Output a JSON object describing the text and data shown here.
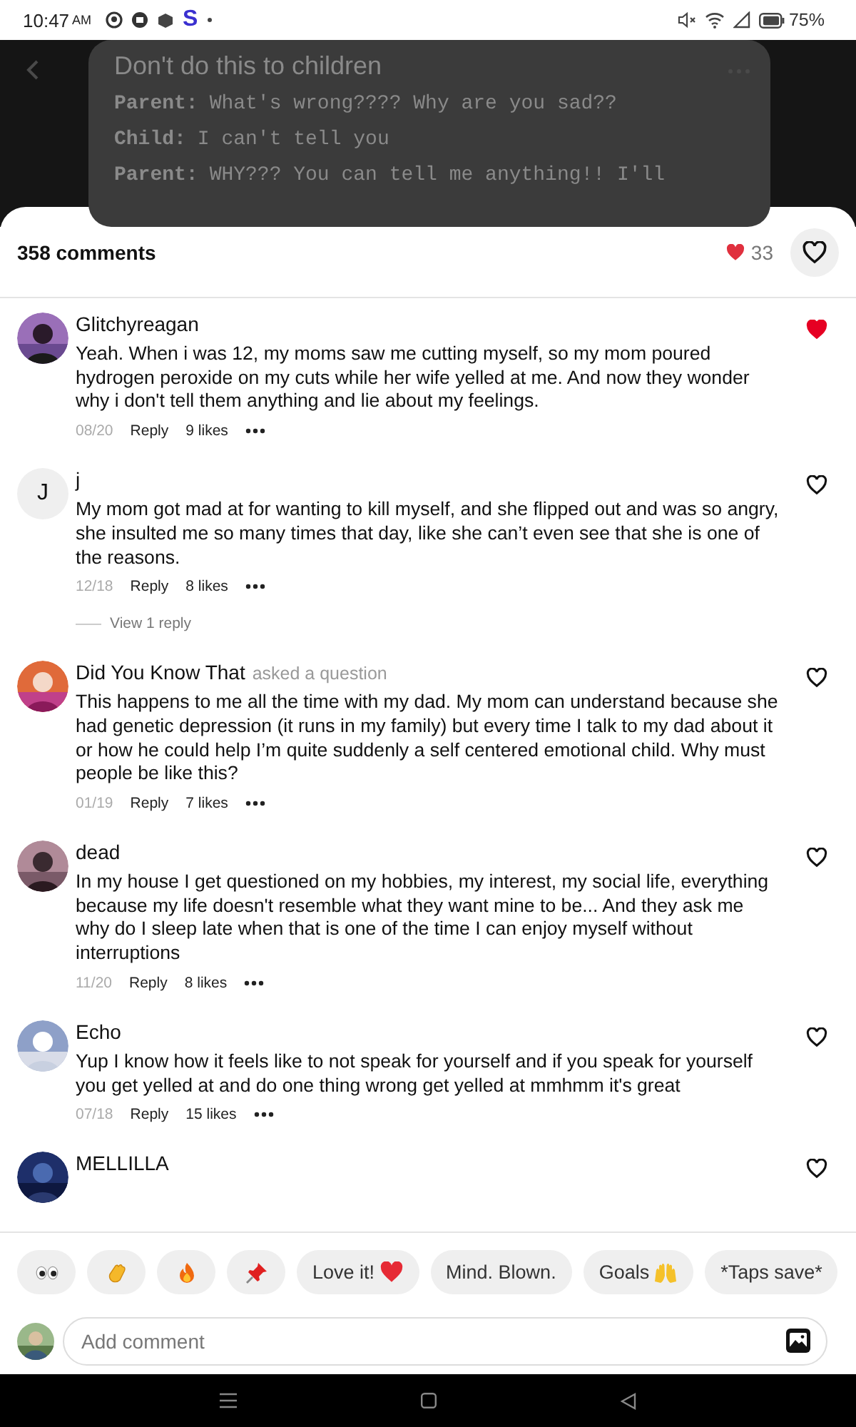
{
  "status_bar": {
    "time": "10:47",
    "ampm": "AM",
    "app_letter": "S",
    "battery": "75%"
  },
  "post": {
    "title": "Don't do this to children",
    "lines": [
      {
        "speaker": "Parent:",
        "text": "What's wrong???? Why are you sad??"
      },
      {
        "speaker": "Child:",
        "text": "I can't tell you"
      },
      {
        "speaker": "Parent:",
        "text": "WHY??? You can tell me anything!! I'll"
      }
    ]
  },
  "sheet": {
    "count": "358 comments",
    "likes": "33",
    "liked": false
  },
  "comments": [
    {
      "kind": "picture",
      "name": "Glitchyreagan",
      "text": "Yeah. When i was 12, my moms saw me cutting myself, so my mom poured hydrogen peroxide on my cuts while her wife yelled at me. And now they wonder why i don't tell them anything and lie about my feelings.",
      "date": "08/20",
      "reply": "Reply",
      "likes": "9 likes",
      "liked": true
    },
    {
      "kind": "letter",
      "initial": "J",
      "name": "j",
      "text": "My mom got mad at for wanting to kill myself, and she flipped out and was so angry, she insulted me so many times that day, like she can’t even see that she is one of the reasons.",
      "date": "12/18",
      "reply": "Reply",
      "likes": "8 likes",
      "liked": false,
      "view_replies": "View 1 reply"
    },
    {
      "kind": "picture",
      "name": "Did You Know That",
      "note": "asked a question",
      "text": "This happens to me all the time with my dad. My mom can understand because she had genetic depression (it runs in my family) but every time I talk to my dad about it or how he could help I’m quite suddenly a self centered emotional child. Why must people be like this?",
      "date": "01/19",
      "reply": "Reply",
      "likes": "7 likes",
      "liked": false
    },
    {
      "kind": "picture",
      "name": "dead",
      "text": "In my house I get questioned on my hobbies, my interest, my social life, everything because my life doesn't resemble what they want mine to be... And they ask me why do I sleep late when that is one of the time I can enjoy myself without interruptions",
      "date": "11/20",
      "reply": "Reply",
      "likes": "8 likes",
      "liked": false
    },
    {
      "kind": "picture",
      "name": "Echo",
      "text": "Yup I know how it feels like to not speak for yourself and if you speak for yourself you get yelled at and do one thing wrong get yelled at mmhmm it's great",
      "date": "07/18",
      "reply": "Reply",
      "likes": "15 likes",
      "liked": false
    },
    {
      "kind": "picture",
      "name": "MELLILLA",
      "liked": false
    }
  ],
  "reactions": [
    {
      "kind": "eyes"
    },
    {
      "kind": "clap"
    },
    {
      "kind": "fire"
    },
    {
      "kind": "pin"
    },
    {
      "kind": "heart",
      "label": "Love it!"
    },
    {
      "kind": "text",
      "label": "Mind. Blown."
    },
    {
      "kind": "hands",
      "label": "Goals"
    },
    {
      "kind": "text",
      "label": "*Taps save*"
    }
  ],
  "composer": {
    "placeholder": "Add comment"
  }
}
